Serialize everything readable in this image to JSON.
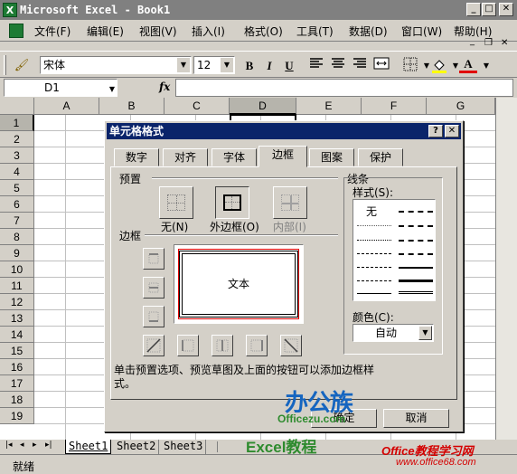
{
  "app": {
    "title": "Microsoft Excel - Book1",
    "icon_letter": "X",
    "controls": {
      "minimize": "_",
      "maximize": "□",
      "close": "✕"
    },
    "doc_controls": {
      "minimize": "_",
      "restore": "❐",
      "close": "✕"
    }
  },
  "menu": {
    "items": [
      "文件(F)",
      "编辑(E)",
      "视图(V)",
      "插入(I)",
      "格式(O)",
      "工具(T)",
      "数据(D)",
      "窗口(W)",
      "帮助(H)"
    ]
  },
  "toolbar": {
    "font": "宋体",
    "font_size": "12",
    "bold": "B",
    "italic": "I",
    "underline": "U",
    "font_color_letter": "A"
  },
  "formula": {
    "cell_ref": "D1",
    "fx": "fx",
    "value": ""
  },
  "grid": {
    "columns": [
      "A",
      "B",
      "C",
      "D",
      "E",
      "F",
      "G"
    ],
    "rows": [
      "1",
      "2",
      "3",
      "4",
      "5",
      "6",
      "7",
      "8",
      "9",
      "10",
      "11",
      "12",
      "13",
      "14",
      "15",
      "16",
      "17",
      "18",
      "19"
    ],
    "selected_cell": "D1"
  },
  "sheets": {
    "nav": [
      "|◂",
      "◂",
      "▸",
      "▸|"
    ],
    "tabs": [
      "Sheet1",
      "Sheet2",
      "Sheet3"
    ],
    "active": "Sheet1"
  },
  "status": {
    "text": "就绪"
  },
  "dialog": {
    "title": "单元格格式",
    "help": "?",
    "close": "✕",
    "tabs": [
      "数字",
      "对齐",
      "字体",
      "边框",
      "图案",
      "保护"
    ],
    "active_tab": "边框",
    "presets_label": "预置",
    "presets": [
      "无(N)",
      "外边框(O)",
      "内部(I)"
    ],
    "border_label": "边框",
    "preview_text": "文本",
    "line_group": "线条",
    "style_label": "样式(S):",
    "style_none": "无",
    "color_label": "颜色(C):",
    "color_value": "自动",
    "hint": "单击预置选项、预览草图及上面的按钮可以添加边框样式。",
    "ok": "确定",
    "cancel": "取消"
  },
  "watermarks": {
    "brand": "办公族",
    "site": "Officezu.com",
    "tutorial": "Excel教程",
    "corner_title": "Office教程学习网",
    "corner_url": "www.office68.com"
  },
  "colors": {
    "title_bar": "#808080",
    "dialog_title": "#0a246a",
    "preview_red": "#e00000",
    "brand_blue": "#1565c0",
    "brand_green": "#2e8b2e",
    "corner_red": "#d40000"
  }
}
